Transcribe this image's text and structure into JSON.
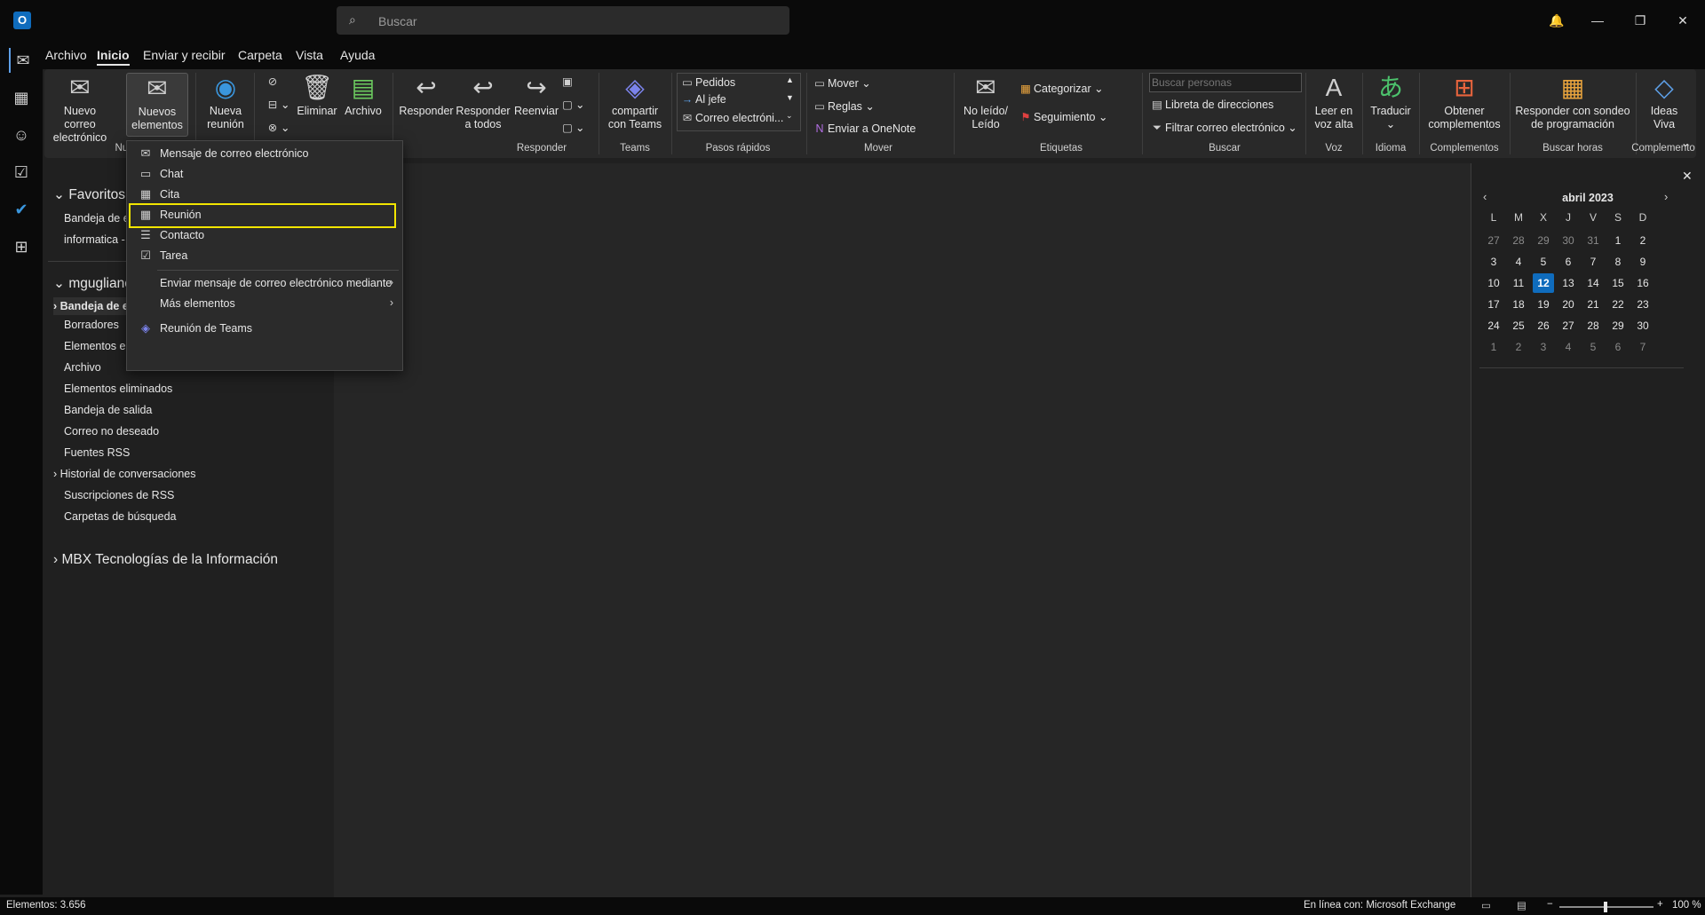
{
  "window": {
    "search_placeholder": "Buscar",
    "controls": {
      "bell": "🔔",
      "minimize": "—",
      "restore": "❐",
      "close": "✕"
    }
  },
  "tabs": [
    "Archivo",
    "Inicio",
    "Enviar y recibir",
    "Carpeta",
    "Vista",
    "Ayuda"
  ],
  "ribbon": {
    "new_email": "Nuevo correo electrónico",
    "new_items": "Nuevos elementos",
    "new_meeting": "Nueva reunión",
    "group_new": "Nue",
    "delete": "Eliminar",
    "archive": "Archivo",
    "reply": "Responder",
    "reply_all": "Responder a todos",
    "forward": "Reenviar",
    "group_respond": "Responder",
    "share_teams": "compartir con Teams",
    "group_teams": "Teams",
    "quick_steps": [
      "Pedidos",
      "Al jefe",
      "Correo electróni..."
    ],
    "group_quick_steps": "Pasos rápidos",
    "move": "Mover",
    "rules": "Reglas",
    "onenote": "Enviar a OneNote",
    "group_move": "Mover",
    "unread_read": "No leído/ Leído",
    "categorize": "Categorizar",
    "followup": "Seguimiento",
    "group_tags": "Etiquetas",
    "search_people_placeholder": "Buscar personas",
    "address_book": "Libreta de direcciones",
    "filter_email": "Filtrar correo electrónico",
    "group_find": "Buscar",
    "read_aloud": "Leer en voz alta",
    "group_voice": "Voz",
    "translate": "Traducir",
    "group_language": "Idioma",
    "get_addins": "Obtener complementos",
    "group_addins": "Complementos",
    "scheduling_poll": "Responder con sondeo de programación",
    "group_find_time": "Buscar horas",
    "viva_ideas": "Ideas Viva",
    "group_addin": "Complemento"
  },
  "folders": {
    "favorites_header": "Favoritos",
    "favorites": [
      "Bandeja de en",
      "informatica -"
    ],
    "account_header": "mguglianc",
    "account_items": [
      "Bandeja de e",
      "Borradores",
      "Elementos en",
      "Archivo",
      "Elementos eliminados",
      "Bandeja de salida",
      "Correo no deseado",
      "Fuentes RSS",
      "Historial de conversaciones",
      "Suscripciones de RSS",
      "Carpetas de búsqueda"
    ],
    "other_account": "MBX Tecnologías de la Información"
  },
  "dropdown": {
    "items": [
      {
        "label": "Mensaje de correo electrónico",
        "icon": "envelope-icon"
      },
      {
        "label": "Chat",
        "icon": "chat-icon"
      },
      {
        "label": "Cita",
        "icon": "calendar-icon"
      },
      {
        "label": "Reunión",
        "icon": "meeting-icon"
      },
      {
        "label": "Contacto",
        "icon": "contact-icon"
      },
      {
        "label": "Tarea",
        "icon": "task-icon"
      },
      {
        "label": "Enviar mensaje de correo electrónico mediante",
        "icon": ""
      },
      {
        "label": "Más elementos",
        "icon": ""
      },
      {
        "label": "Reunión de Teams",
        "icon": "teams-icon"
      }
    ]
  },
  "calendar": {
    "month": "abril 2023",
    "weekdays": [
      "L",
      "M",
      "X",
      "J",
      "V",
      "S",
      "D"
    ],
    "weeks": [
      [
        "27",
        "28",
        "29",
        "30",
        "31",
        "1",
        "2"
      ],
      [
        "3",
        "4",
        "5",
        "6",
        "7",
        "8",
        "9"
      ],
      [
        "10",
        "11",
        "12",
        "13",
        "14",
        "15",
        "16"
      ],
      [
        "17",
        "18",
        "19",
        "20",
        "21",
        "22",
        "23"
      ],
      [
        "24",
        "25",
        "26",
        "27",
        "28",
        "29",
        "30"
      ],
      [
        "1",
        "2",
        "3",
        "4",
        "5",
        "6",
        "7"
      ]
    ],
    "today": "12",
    "accent": "#0f6cbd"
  },
  "status": {
    "items": "Elementos: 3.656",
    "connection": "En línea con: Microsoft Exchange",
    "zoom": "100 %"
  }
}
